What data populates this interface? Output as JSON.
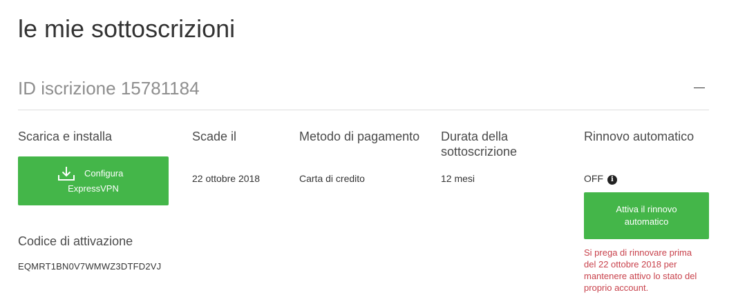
{
  "page": {
    "title": "le mie sottoscrizioni"
  },
  "subscription": {
    "id_label": "ID iscrizione 15781184",
    "columns": {
      "download": {
        "header": "Scarica e installa",
        "button_line1": "Configura",
        "button_line2": "ExpressVPN",
        "icon": "download-icon"
      },
      "expires": {
        "header": "Scade il",
        "value": "22 ottobre 2018"
      },
      "payment": {
        "header": "Metodo di pagamento",
        "value": "Carta di credito"
      },
      "duration": {
        "header_line1": "Durata della",
        "header_line2": "sottoscrizione",
        "value": "12 mesi"
      },
      "auto_renew": {
        "header": "Rinnovo automatico",
        "status": "OFF",
        "info_icon": "info-icon",
        "button_line1": "Attiva il rinnovo",
        "button_line2": "automatico",
        "warning_lines": [
          "Si prega di rinnovare prima",
          "del 22 ottobre 2018 per",
          "mantenere attivo lo stato del",
          "proprio account."
        ]
      }
    },
    "activation": {
      "header": "Codice di attivazione",
      "code": "EQMRT1BN0V7WMWZ3DTFD2VJ"
    }
  },
  "colors": {
    "accent_green": "#44b649",
    "warning_red": "#c8414b",
    "muted_text": "#8e8e8e"
  }
}
